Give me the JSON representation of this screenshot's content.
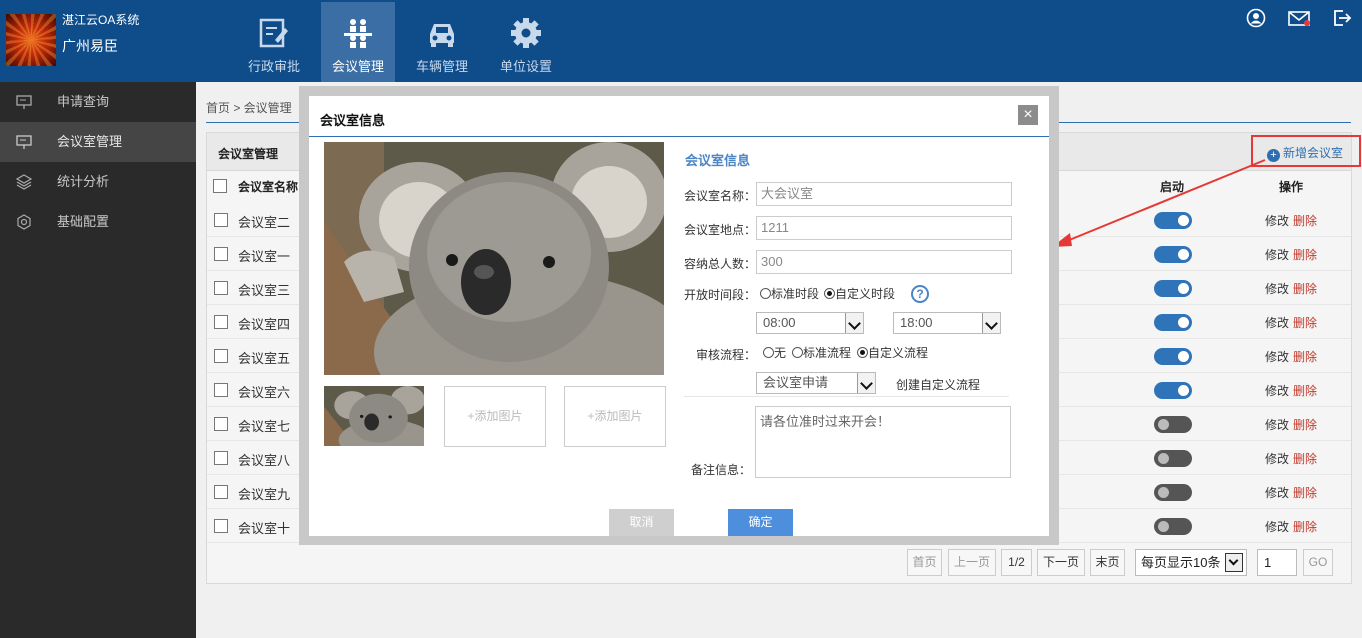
{
  "header": {
    "system_name": "湛江云OA系统",
    "company": "广州易臣",
    "nav": [
      {
        "label": "行政审批",
        "icon": "edit-document-icon"
      },
      {
        "label": "会议管理",
        "icon": "meeting-people-icon",
        "active": true
      },
      {
        "label": "车辆管理",
        "icon": "car-icon"
      },
      {
        "label": "单位设置",
        "icon": "gear-icon"
      }
    ],
    "right_icons": [
      "user-icon",
      "mail-icon",
      "logout-icon"
    ]
  },
  "sidebar": {
    "items": [
      {
        "label": "申请查询",
        "icon": "presentation-icon"
      },
      {
        "label": "会议室管理",
        "icon": "presentation-icon",
        "active": true
      },
      {
        "label": "统计分析",
        "icon": "layers-icon"
      },
      {
        "label": "基础配置",
        "icon": "settings-icon"
      }
    ]
  },
  "breadcrumb": "首页 > 会议管理",
  "panel": {
    "title": "会议室管理",
    "add_button": "新增会议室",
    "columns": {
      "name": "会议室名称",
      "enabled": "启动",
      "actions": "操作"
    },
    "rows": [
      {
        "name": "会议室二",
        "enabled": true
      },
      {
        "name": "会议室一",
        "enabled": true
      },
      {
        "name": "会议室三",
        "enabled": true
      },
      {
        "name": "会议室四",
        "enabled": true
      },
      {
        "name": "会议室五",
        "enabled": true
      },
      {
        "name": "会议室六",
        "enabled": true
      },
      {
        "name": "会议室七",
        "enabled": false
      },
      {
        "name": "会议室八",
        "enabled": false
      },
      {
        "name": "会议室九",
        "enabled": false
      },
      {
        "name": "会议室十",
        "enabled": false
      }
    ],
    "edit_label": "修改",
    "delete_label": "删除"
  },
  "pagination": {
    "first": "首页",
    "prev": "上一页",
    "current": "1/2",
    "next": "下一页",
    "last": "末页",
    "per_page": "每页显示10条",
    "page_input": "1",
    "go": "GO"
  },
  "modal": {
    "title": "会议室信息",
    "close": "×",
    "form_title": "会议室信息",
    "add_image": "+添加图片",
    "name_label": "会议室名称：",
    "name_value": "大会议室",
    "location_label": "会议室地点：",
    "location_value": "1211",
    "capacity_label": "容纳总人数：",
    "capacity_value": "300",
    "time_label": "开放时间段：",
    "time_standard": "标准时段",
    "time_custom": "自定义时段",
    "time_start": "08:00",
    "time_end": "18:00",
    "flow_label": "审核流程：",
    "flow_none": "无",
    "flow_standard": "标准流程",
    "flow_custom": "自定义流程",
    "flow_select": "会议室申请",
    "create_flow": "创建自定义流程",
    "remark_label": "备注信息：",
    "remark_value": "请各位准时过来开会！",
    "help": "?",
    "cancel": "取消",
    "ok": "确定"
  },
  "colors": {
    "header": "#0f4c8a",
    "accent": "#2f6fb0",
    "delete": "#c0392b",
    "highlight": "#e53935"
  }
}
